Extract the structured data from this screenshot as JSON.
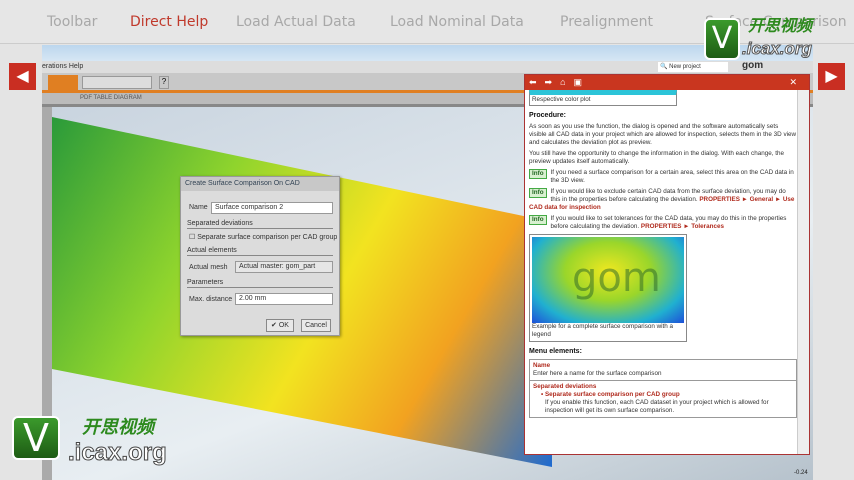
{
  "nav": {
    "items": [
      "Toolbar",
      "Direct Help",
      "Load Actual Data",
      "Load Nominal Data",
      "Prealignment",
      "Surface Comparison"
    ],
    "active": "Direct Help"
  },
  "app": {
    "menu": "erations  Help",
    "tabs": "PDF  TABLE  DIAGRAM",
    "search": "New project",
    "brand": "gom"
  },
  "dialog": {
    "title": "Create Surface Comparison On CAD",
    "name_label": "Name",
    "name_value": "Surface comparison 2",
    "sec1": "Separated deviations",
    "checkbox": "Separate surface comparison per CAD group",
    "sec2": "Actual elements",
    "mesh_label": "Actual mesh",
    "mesh_value": "Actual master: gom_part",
    "sec3": "Parameters",
    "dist_label": "Max. distance",
    "dist_value": "2.00 mm",
    "ok": "OK",
    "cancel": "Cancel"
  },
  "help": {
    "caption_top": "Respective color plot",
    "procedure": "Procedure:",
    "p1": "As soon as you use the function, the dialog is opened and the software automatically sets visible all CAD data in your project which are allowed for inspection, selects them in the 3D view and calculates the deviation plot as preview.",
    "p2": "You still have the opportunity to change the information in the dialog. With each change, the preview updates itself automatically.",
    "info": "Info",
    "i1": "If you need a surface comparison for a certain area, select this area on the CAD data in the 3D view.",
    "i2": "If you would like to exclude certain CAD data from the surface deviation, you may do this in the properties before calculating the deviation.",
    "i2link": "PROPERTIES ► General ► Use CAD data for inspection",
    "i3": "If you would like to set tolerances for the CAD data, you may do this in the properties before calculating the deviation.",
    "i3link": "PROPERTIES ► Tolerances",
    "img_text": "gom",
    "img_caption": "Example for a complete surface comparison with a legend",
    "menu_elements": "Menu elements:",
    "name_h": "Name",
    "name_t": "Enter here a name for the surface comparison",
    "sep_h": "Separated deviations",
    "sep_item": "Separate surface comparison per CAD group",
    "sep_t": "If you enable this function, each CAD dataset in your project which is allowed for inspection will get its own surface comparison."
  },
  "legend_value": "-0.24",
  "watermark": {
    "cn": "开思视频",
    "url": ".icax.org",
    "v": "V"
  }
}
